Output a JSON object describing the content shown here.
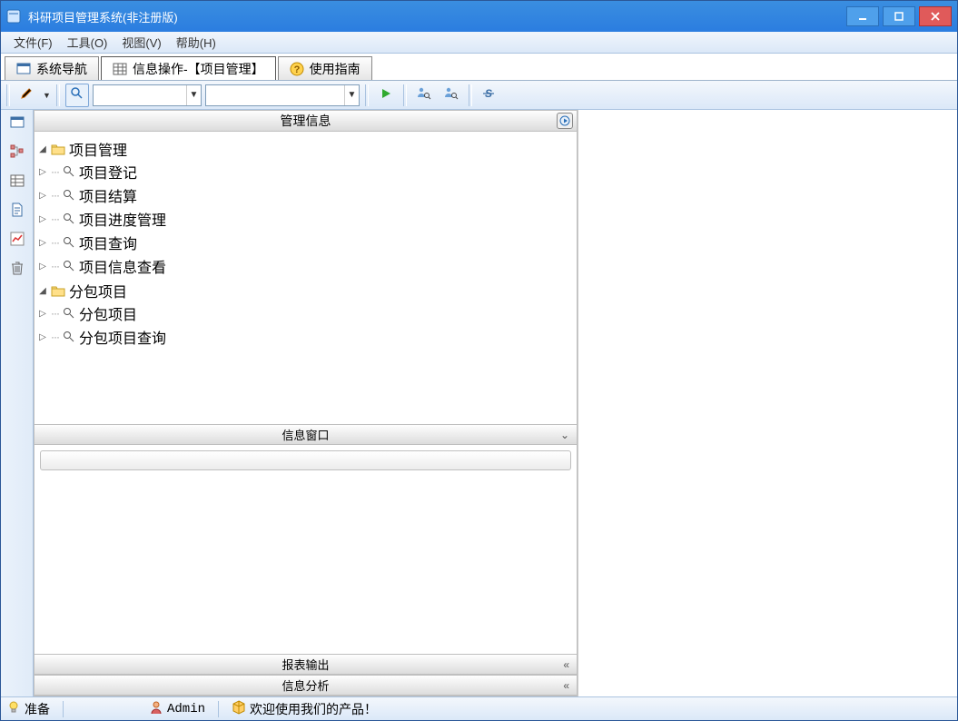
{
  "title": "科研项目管理系统(非注册版)",
  "menu": {
    "file": "文件(F)",
    "tools": "工具(O)",
    "view": "视图(V)",
    "help": "帮助(H)"
  },
  "tabs": {
    "nav": "系统导航",
    "ops": "信息操作-【项目管理】",
    "guide": "使用指南"
  },
  "panels": {
    "mgmt_info": "管理信息",
    "info_window": "信息窗口",
    "report_output": "报表输出",
    "info_analysis": "信息分析"
  },
  "tree": {
    "project_mgmt": {
      "label": "项目管理",
      "children": {
        "register": "项目登记",
        "settle": "项目结算",
        "progress": "项目进度管理",
        "query": "项目查询",
        "info_view": "项目信息查看"
      }
    },
    "subcontract": {
      "label": "分包项目",
      "children": {
        "sub_project": "分包项目",
        "sub_query": "分包项目查询"
      }
    }
  },
  "status": {
    "ready": "准备",
    "user": "Admin",
    "welcome": "欢迎使用我们的产品！"
  }
}
